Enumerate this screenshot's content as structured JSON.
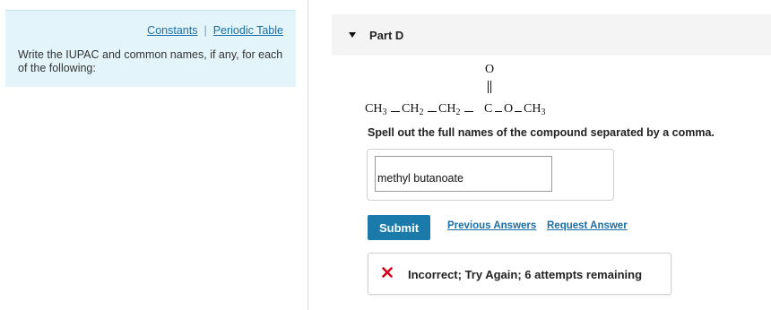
{
  "left_panel": {
    "links": {
      "constants": "Constants",
      "separator": "|",
      "periodic_table": "Periodic Table"
    },
    "instructions": "Write the IUPAC and common names, if any, for each of the following:"
  },
  "part": {
    "title": "Part D"
  },
  "structure": {
    "top_atom": "O",
    "double_bond": "||",
    "chain": [
      {
        "base": "CH",
        "sub": "3"
      },
      {
        "base": "CH",
        "sub": "2"
      },
      {
        "base": "CH",
        "sub": "2"
      },
      {
        "base": "C",
        "sub": ""
      },
      {
        "base": "O",
        "sub": ""
      },
      {
        "base": "CH",
        "sub": "3"
      }
    ]
  },
  "prompt": "Spell out the full names of the compound separated by a comma.",
  "answer": {
    "value": "methyl butanoate"
  },
  "buttons": {
    "submit": "Submit",
    "previous_answers": "Previous Answers",
    "request_answer": "Request Answer"
  },
  "feedback": {
    "icon": "x-icon",
    "text": "Incorrect; Try Again; 6 attempts remaining",
    "icon_color": "#d0021b"
  },
  "colors": {
    "panel_bg": "#e3f5fa",
    "link": "#1a6ea8",
    "submit_bg": "#1a7bab",
    "header_bg": "#f4f4f4"
  }
}
